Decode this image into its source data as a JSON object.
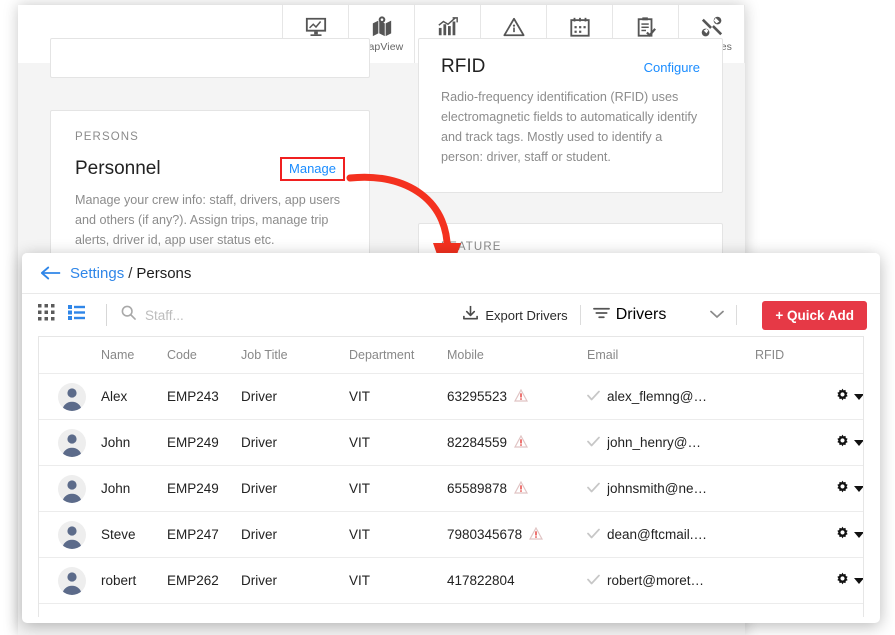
{
  "topnav": {
    "items": [
      {
        "label": "Dashboard",
        "icon": "dashboard-icon"
      },
      {
        "label": "MapView",
        "icon": "mapview-icon"
      },
      {
        "label": "Analytics",
        "icon": "analytics-icon"
      },
      {
        "label": "Alerts",
        "icon": "alerts-icon"
      },
      {
        "label": "Schedule",
        "icon": "schedule-icon"
      },
      {
        "label": "Reports",
        "icon": "reports-icon"
      },
      {
        "label": "Services",
        "icon": "services-icon"
      }
    ]
  },
  "cards": {
    "persons": {
      "eyebrow": "PERSONS",
      "title": "Personnel",
      "link": "Manage",
      "body": "Manage your crew info: staff, drivers, app users and others (if any?). Assign trips, manage trip alerts, driver id, app user status etc."
    },
    "rfid": {
      "title": "RFID",
      "link": "Configure",
      "body": "Radio-frequency identification (RFID) uses electromagnetic fields to automatically identify and track tags. Mostly used to identify a person: driver, staff or student."
    },
    "feature": {
      "eyebrow": "FEATURE"
    }
  },
  "modal": {
    "breadcrumb": {
      "back_icon": "back-arrow-icon",
      "parent": "Settings",
      "separator": "/",
      "current": "Persons"
    },
    "toolbar": {
      "grid_view_icon": "grid-view-icon",
      "list_view_icon": "list-view-icon",
      "search_icon": "search-icon",
      "search_value": "",
      "search_placeholder": "Staff...",
      "export_label": "Export Drivers",
      "export_icon": "download-icon",
      "filter_label": "Drivers",
      "filter_icon": "filter-icon",
      "filter_caret_icon": "chevron-down-icon",
      "quick_add_label": "+ Quick Add"
    },
    "table": {
      "columns": [
        "Name",
        "Code",
        "Job Title",
        "Department",
        "Mobile",
        "Email",
        "RFID"
      ],
      "rows": [
        {
          "avatar": "person-avatar-icon",
          "name": "Alex",
          "code": "EMP243",
          "job": "Driver",
          "dept": "VIT",
          "mobile": "63295523",
          "mobile_warn": true,
          "email": "alex_flemng@…",
          "email_verified": true,
          "rfid": ""
        },
        {
          "avatar": "person-avatar-icon",
          "name": "John",
          "code": "EMP249",
          "job": "Driver",
          "dept": "VIT",
          "mobile": "82284559",
          "mobile_warn": true,
          "email": "john_henry@…",
          "email_verified": true,
          "rfid": ""
        },
        {
          "avatar": "person-avatar-icon",
          "name": "John",
          "code": "EMP249",
          "job": "Driver",
          "dept": "VIT",
          "mobile": "65589878",
          "mobile_warn": true,
          "email": "johnsmith@ne…",
          "email_verified": true,
          "rfid": ""
        },
        {
          "avatar": "person-avatar-icon",
          "name": "Steve",
          "code": "EMP247",
          "job": "Driver",
          "dept": "VIT",
          "mobile": "7980345678",
          "mobile_warn": true,
          "email": "dean@ftcmail.…",
          "email_verified": true,
          "rfid": ""
        },
        {
          "avatar": "person-avatar-icon",
          "name": "robert",
          "code": "EMP262",
          "job": "Driver",
          "dept": "VIT",
          "mobile": "417822804",
          "mobile_warn": false,
          "email": "robert@moret…",
          "email_verified": true,
          "rfid": ""
        }
      ],
      "row_action_icon": "gear-icon",
      "row_action_caret_icon": "caret-down-icon"
    }
  },
  "annotation": {
    "arrow_icon": "red-curved-arrow",
    "highlight_color": "#f02020",
    "accent_color": "#1a8cff",
    "quick_add_color": "#e63946"
  }
}
